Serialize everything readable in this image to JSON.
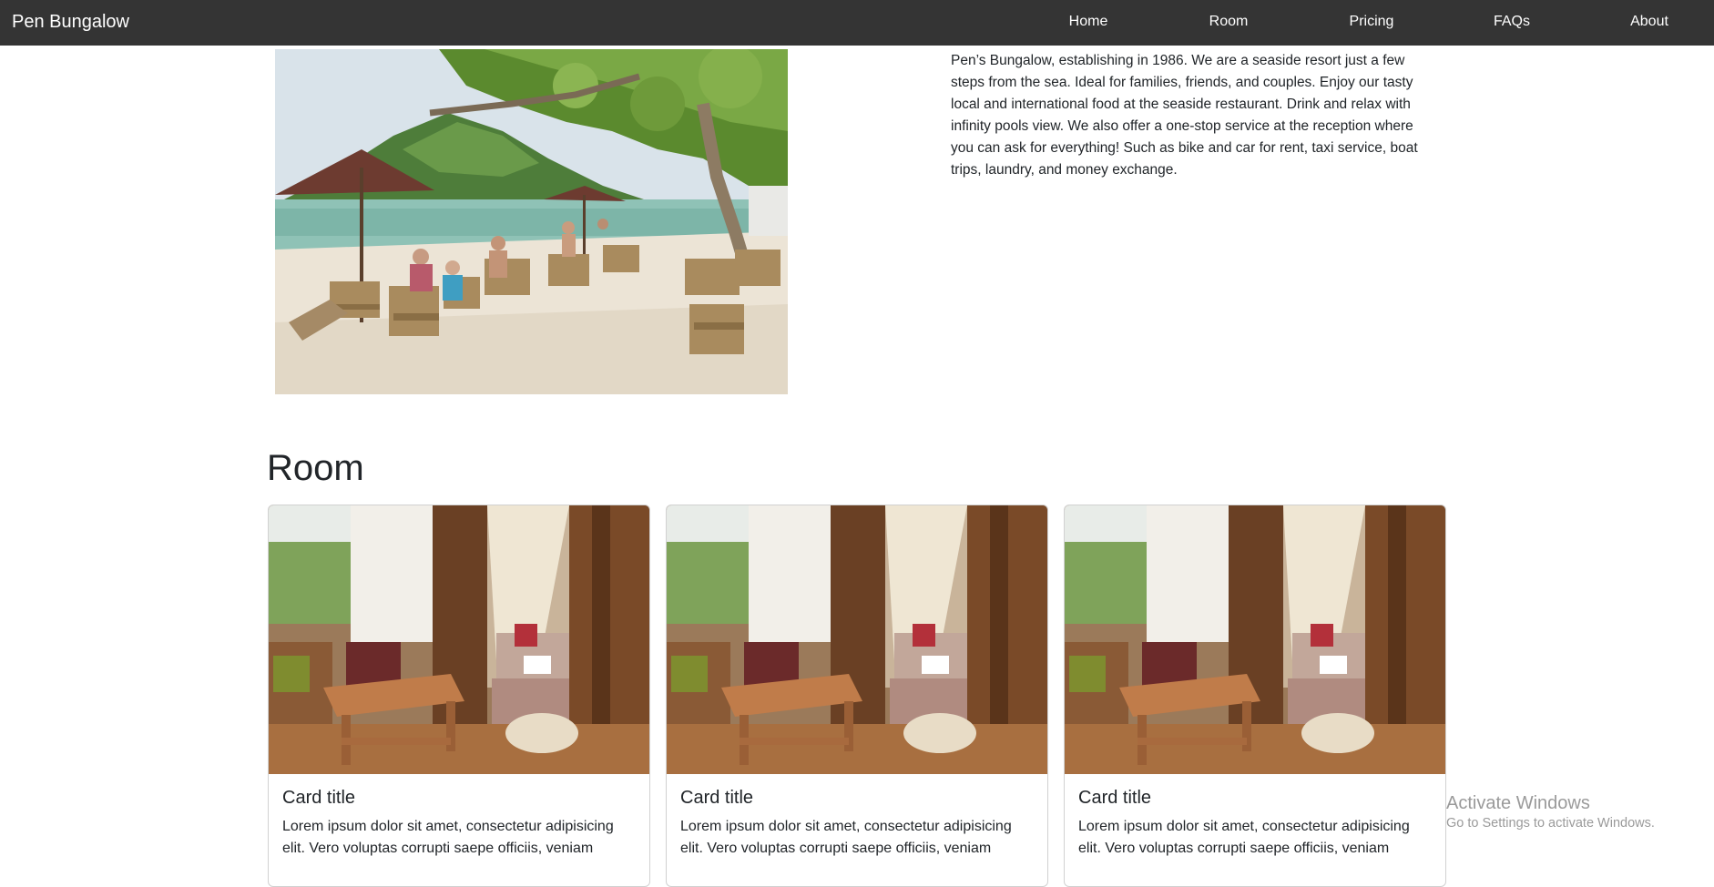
{
  "navbar": {
    "brand": "Pen Bungalow",
    "links": [
      "Home",
      "Room",
      "Pricing",
      "FAQs",
      "About"
    ]
  },
  "hero": {
    "image_alt": "beach-restaurant-photo",
    "description": "Pen’s Bungalow, establishing in 1986. We are a seaside resort just a few steps from the sea. Ideal for families, friends, and couples. Enjoy our tasty local and international food at the seaside restaurant. Drink and relax with infinity pools view. We also offer a one-stop service at the reception where you can ask for everything! Such as bike and car for rent, taxi service, boat trips, laundry, and money exchange."
  },
  "room_section": {
    "title": "Room",
    "cards": [
      {
        "title": "Card title",
        "text": "Lorem ipsum dolor sit amet, consectetur adipisicing elit. Vero voluptas corrupti saepe officiis, veniam"
      },
      {
        "title": "Card title",
        "text": "Lorem ipsum dolor sit amet, consectetur adipisicing elit. Vero voluptas corrupti saepe officiis, veniam"
      },
      {
        "title": "Card title",
        "text": "Lorem ipsum dolor sit amet, consectetur adipisicing elit. Vero voluptas corrupti saepe officiis, veniam"
      }
    ]
  },
  "watermark": {
    "title": "Activate Windows",
    "subtitle": "Go to Settings to activate Windows."
  },
  "colors": {
    "navbar_bg": "#343434",
    "nav_text": "#ffffff",
    "body_text": "#212529"
  }
}
